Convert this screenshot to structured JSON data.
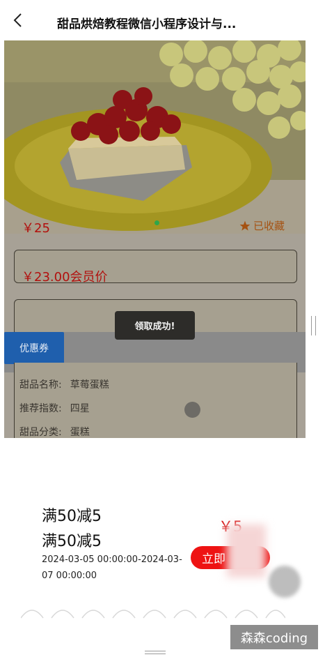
{
  "header": {
    "title": "甜品烘焙教程微信小程序设计与..."
  },
  "product": {
    "price": "￥25",
    "favorite_label": "已收藏",
    "member_price": "￥23.00会员价"
  },
  "tabs": {
    "coupon_label": "优惠券"
  },
  "toast": {
    "message": "领取成功!"
  },
  "details": [
    {
      "label": "甜品名称:",
      "value": "草莓蛋糕"
    },
    {
      "label": "推荐指数:",
      "value": "四星"
    },
    {
      "label": "甜品分类:",
      "value": "蛋糕"
    }
  ],
  "coupon": {
    "title_line1": "满50减5",
    "title_line2": "满50减5",
    "date_range": "2024-03-05 00:00:00-2024-03-07 00:00:00",
    "amount": "￥5",
    "button_label": "立即"
  },
  "watermark": "森森coding",
  "colors": {
    "accent_red": "#ee1313",
    "coupon_tab_blue": "#1f5fad",
    "price_red": "#b2100e"
  },
  "carousel": {
    "active_index": 0
  }
}
